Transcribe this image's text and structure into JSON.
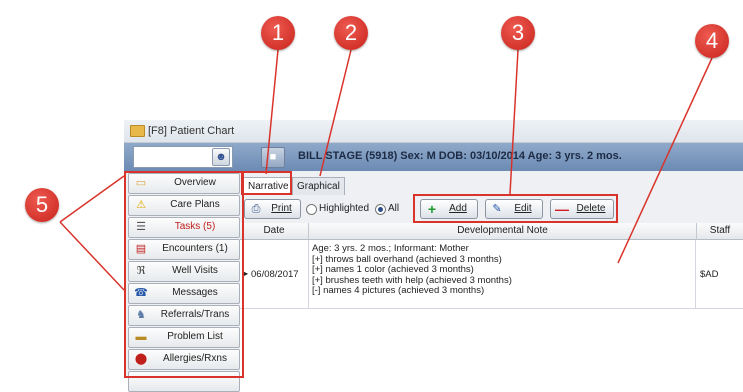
{
  "window": {
    "title": "[F8] Patient Chart"
  },
  "header": {
    "search_value": "",
    "patient_info": "BILL STAGE (5918)  Sex: M  DOB: 03/10/2014  Age: 3 yrs. 2 mos."
  },
  "sidebar": {
    "items": [
      {
        "label": "Overview",
        "icon": "folder-icon"
      },
      {
        "label": "Care Plans",
        "icon": "warning-icon"
      },
      {
        "label": "Tasks (5)",
        "icon": "checklist-icon"
      },
      {
        "label": "Encounters (1)",
        "icon": "encounter-icon"
      },
      {
        "label": "Well Visits",
        "icon": "stethoscope-icon"
      },
      {
        "label": "Messages",
        "icon": "phone-icon"
      },
      {
        "label": "Referrals/Trans",
        "icon": "referral-icon"
      },
      {
        "label": "Problem List",
        "icon": "list-icon"
      },
      {
        "label": "Allergies/Rxns",
        "icon": "allergy-icon"
      }
    ]
  },
  "tabs": [
    {
      "label": "Narrative"
    },
    {
      "label": "Graphical"
    }
  ],
  "toolbar": {
    "print_label": "Print",
    "highlighted_label": "Highlighted",
    "all_label": "All",
    "add_label": "Add",
    "edit_label": "Edit",
    "delete_label": "Delete"
  },
  "table": {
    "headers": [
      "Date",
      "Developmental Note",
      "Staff"
    ],
    "rows": [
      {
        "date": "06/08/2017",
        "note_lines": [
          "Age: 3 yrs. 2 mos.; Informant: Mother",
          "[+] throws ball overhand (achieved 3 months)",
          "[+] names 1 color (achieved 3 months)",
          "[+] brushes teeth with help (achieved 3 months)",
          "[-] names 4 pictures (achieved 3 months)"
        ],
        "staff": "$AD"
      }
    ]
  },
  "callouts": [
    "1",
    "2",
    "3",
    "4",
    "5"
  ],
  "colors": {
    "callout": "#d9342b",
    "header": "#7d99bf"
  }
}
